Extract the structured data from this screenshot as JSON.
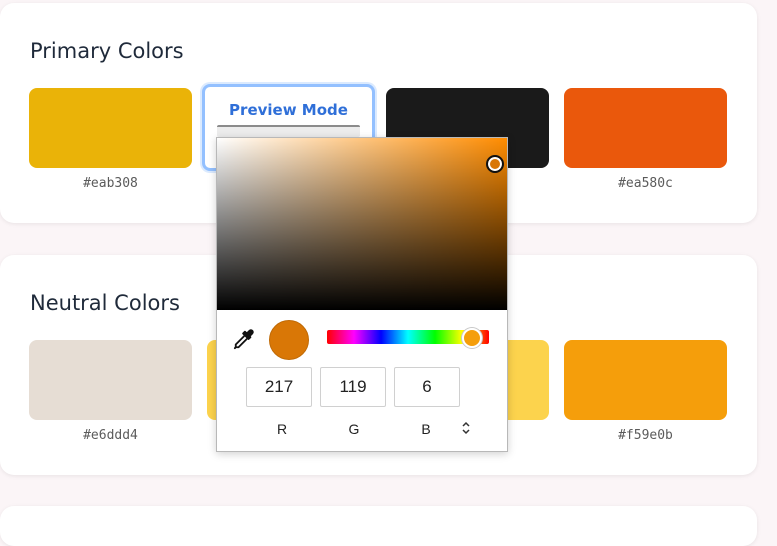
{
  "sections": [
    {
      "title": "Primary Colors",
      "swatches": [
        {
          "color": "#eab308",
          "label": "#eab308"
        },
        {
          "color": "#ffffff",
          "label": ""
        },
        {
          "color": "#1a1a1a",
          "label": ""
        },
        {
          "color": "#ea580c",
          "label": "#ea580c"
        }
      ]
    },
    {
      "title": "Neutral Colors",
      "swatches": [
        {
          "color": "#e6ddd4",
          "label": "#e6ddd4"
        },
        {
          "color": "#fcd34d",
          "label": ""
        },
        {
          "color": "#fcd34d",
          "label": ""
        },
        {
          "color": "#f59e0b",
          "label": "#f59e0b"
        }
      ]
    }
  ],
  "preview": {
    "label": "Preview Mode"
  },
  "picker": {
    "current_color": "#d97706",
    "hue_color": "#f59e0b",
    "icons": {
      "eyedropper": "eyedropper-icon",
      "toggle": "up-down-chevron-icon"
    },
    "channels": [
      {
        "label": "R",
        "value": "217"
      },
      {
        "label": "G",
        "value": "119"
      },
      {
        "label": "B",
        "value": "6"
      }
    ]
  }
}
